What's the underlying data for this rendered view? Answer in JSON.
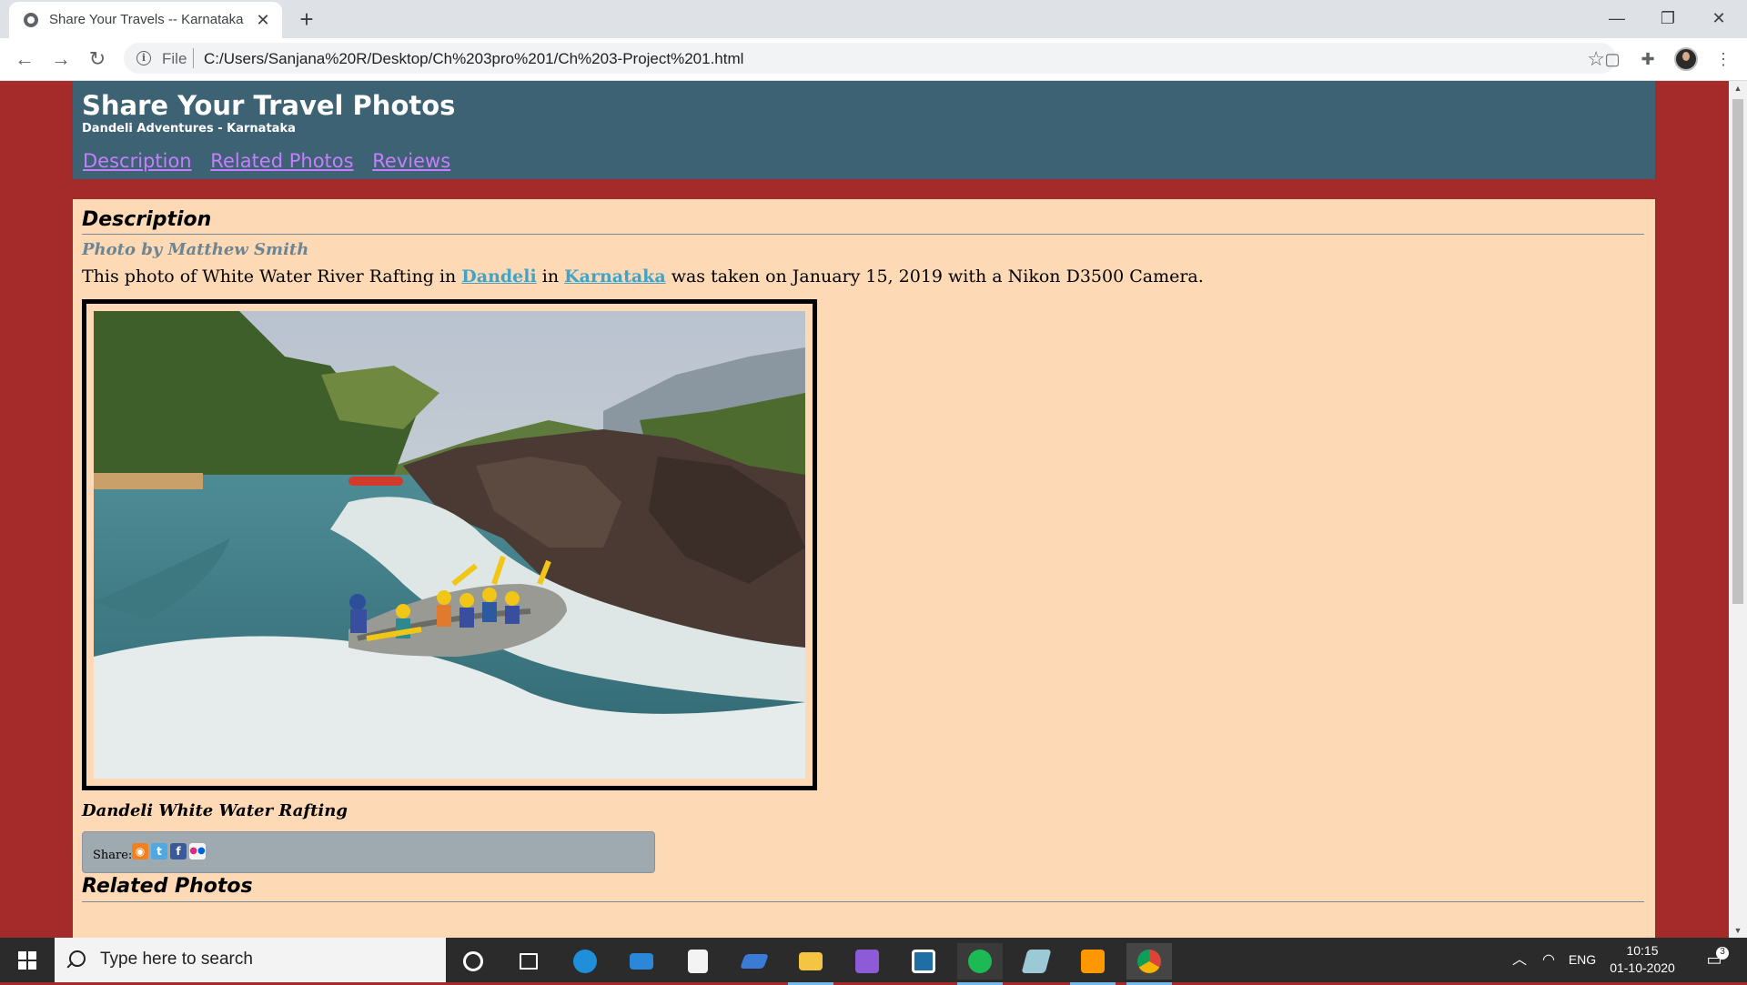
{
  "browser": {
    "tab_title": "Share Your Travels -- Karnataka",
    "url_scheme": "File",
    "url": "C:/Users/Sanjana%20R/Desktop/Ch%203pro%201/Ch%203-Project%201.html"
  },
  "site": {
    "title": "Share Your Travel Photos",
    "subtitle": "Dandeli Adventures - Karnataka",
    "nav": [
      "Description",
      "Related Photos",
      "Reviews"
    ]
  },
  "description": {
    "heading": "Description",
    "credit": "Photo by Matthew Smith",
    "text_before": "This photo of White Water River Rafting in ",
    "link_1": "Dandeli",
    "text_mid": " in ",
    "link_2": "Karnataka",
    "text_after": " was taken on January 15, 2019 with a Nikon D3500 Camera.",
    "caption": "Dandeli White Water Rafting"
  },
  "share": {
    "label": "Share:",
    "icons": [
      "rss-icon",
      "twitter-icon",
      "facebook-icon",
      "flickr-icon"
    ]
  },
  "related": {
    "heading": "Related Photos"
  },
  "taskbar": {
    "search_placeholder": "Type here to search",
    "language": "ENG",
    "time": "10:15",
    "date": "01-10-2020",
    "notification_count": "3"
  },
  "colors": {
    "page_background": "#a52a2a",
    "header_background": "#3d6273",
    "content_background": "#fdd9b5",
    "nav_link": "#c77dff",
    "inline_link": "#3fa4c8"
  }
}
